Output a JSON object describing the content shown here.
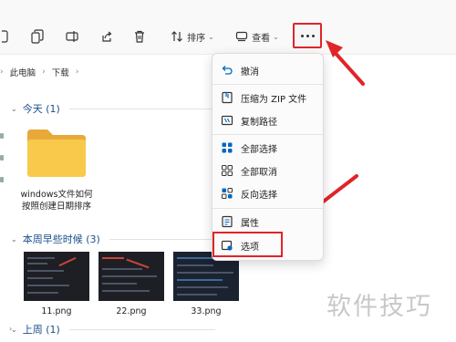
{
  "toolbar": {
    "sort_label": "排序",
    "view_label": "查看",
    "chevron": "⌄"
  },
  "breadcrumb": [
    "此电脑",
    "下载"
  ],
  "groups": {
    "today": "今天 (1)",
    "earlier_this_week": "本周早些时候 (3)",
    "last_week": "上周 (1)"
  },
  "folder": {
    "name": "windows文件如何按照创建日期排序"
  },
  "images": [
    {
      "name": "11.png"
    },
    {
      "name": "22.png"
    },
    {
      "name": "33.png"
    }
  ],
  "menu": {
    "items": [
      {
        "label": "撤消",
        "icon": "undo-icon"
      },
      {
        "label": "压缩为 ZIP 文件",
        "icon": "zip-icon"
      },
      {
        "label": "复制路径",
        "icon": "copy-path-icon"
      },
      {
        "label": "全部选择",
        "icon": "select-all-icon"
      },
      {
        "label": "全部取消",
        "icon": "select-none-icon"
      },
      {
        "label": "反向选择",
        "icon": "invert-selection-icon"
      },
      {
        "label": "属性",
        "icon": "properties-icon"
      },
      {
        "label": "选项",
        "icon": "options-icon"
      }
    ]
  },
  "watermark": "软件技巧",
  "colors": {
    "accent": "#0067c0",
    "annotation_red": "#e0242a",
    "folder_yellow": "#f8c94a"
  }
}
